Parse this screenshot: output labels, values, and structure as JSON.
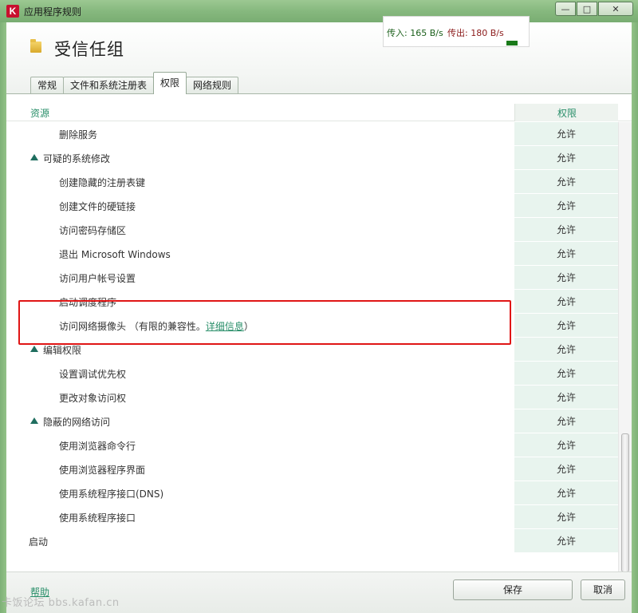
{
  "window": {
    "title": "应用程序规则",
    "minimize_glyph": "—",
    "maximize_glyph": "□",
    "close_glyph": "✕"
  },
  "header": {
    "title": "受信任组"
  },
  "traffic": {
    "in_text": "传入: 165 B/s",
    "out_text": "传出: 180 B/s"
  },
  "tabs": [
    {
      "label": "常规",
      "active": false
    },
    {
      "label": "文件和系统注册表",
      "active": false
    },
    {
      "label": "权限",
      "active": true
    },
    {
      "label": "网络规则",
      "active": false
    }
  ],
  "table": {
    "col_resource": "资源",
    "col_permission": "权限",
    "rows": [
      {
        "label": "删除服务",
        "level": 2,
        "permission": "允许"
      },
      {
        "label": "可疑的系统修改",
        "level": 1,
        "expanded": true,
        "permission": "允许"
      },
      {
        "label": "创建隐藏的注册表键",
        "level": 2,
        "permission": "允许"
      },
      {
        "label": "创建文件的硬链接",
        "level": 2,
        "permission": "允许"
      },
      {
        "label": "访问密码存储区",
        "level": 2,
        "permission": "允许"
      },
      {
        "label": "退出 Microsoft Windows",
        "level": 2,
        "permission": "允许"
      },
      {
        "label": "访问用户帐号设置",
        "level": 2,
        "permission": "允许"
      },
      {
        "label": "启动调度程序",
        "level": 2,
        "permission": "允许"
      },
      {
        "label": "访问网络摄像头 （有限的兼容性。",
        "level": 2,
        "permission": "允许",
        "link": "详细信息",
        "suffix": "）"
      },
      {
        "label": "编辑权限",
        "level": 1,
        "expanded": true,
        "permission": "允许"
      },
      {
        "label": "设置调试优先权",
        "level": 2,
        "permission": "允许"
      },
      {
        "label": "更改对象访问权",
        "level": 2,
        "permission": "允许"
      },
      {
        "label": "隐蔽的网络访问",
        "level": 1,
        "expanded": true,
        "permission": "允许"
      },
      {
        "label": "使用浏览器命令行",
        "level": 2,
        "permission": "允许"
      },
      {
        "label": "使用浏览器程序界面",
        "level": 2,
        "permission": "允许"
      },
      {
        "label": "使用系统程序接口(DNS)",
        "level": 2,
        "permission": "允许"
      },
      {
        "label": "使用系统程序接口",
        "level": 2,
        "permission": "允许"
      },
      {
        "label": "启动",
        "level": 0,
        "permission": "允许"
      }
    ]
  },
  "footer": {
    "help": "帮助",
    "save": "保存",
    "cancel": "取消"
  },
  "watermark": "卡饭论坛 bbs.kafan.cn",
  "colors": {
    "accent": "#2a8f6a",
    "highlight": "#e01515",
    "permission_bg": "#e8f4ee"
  }
}
